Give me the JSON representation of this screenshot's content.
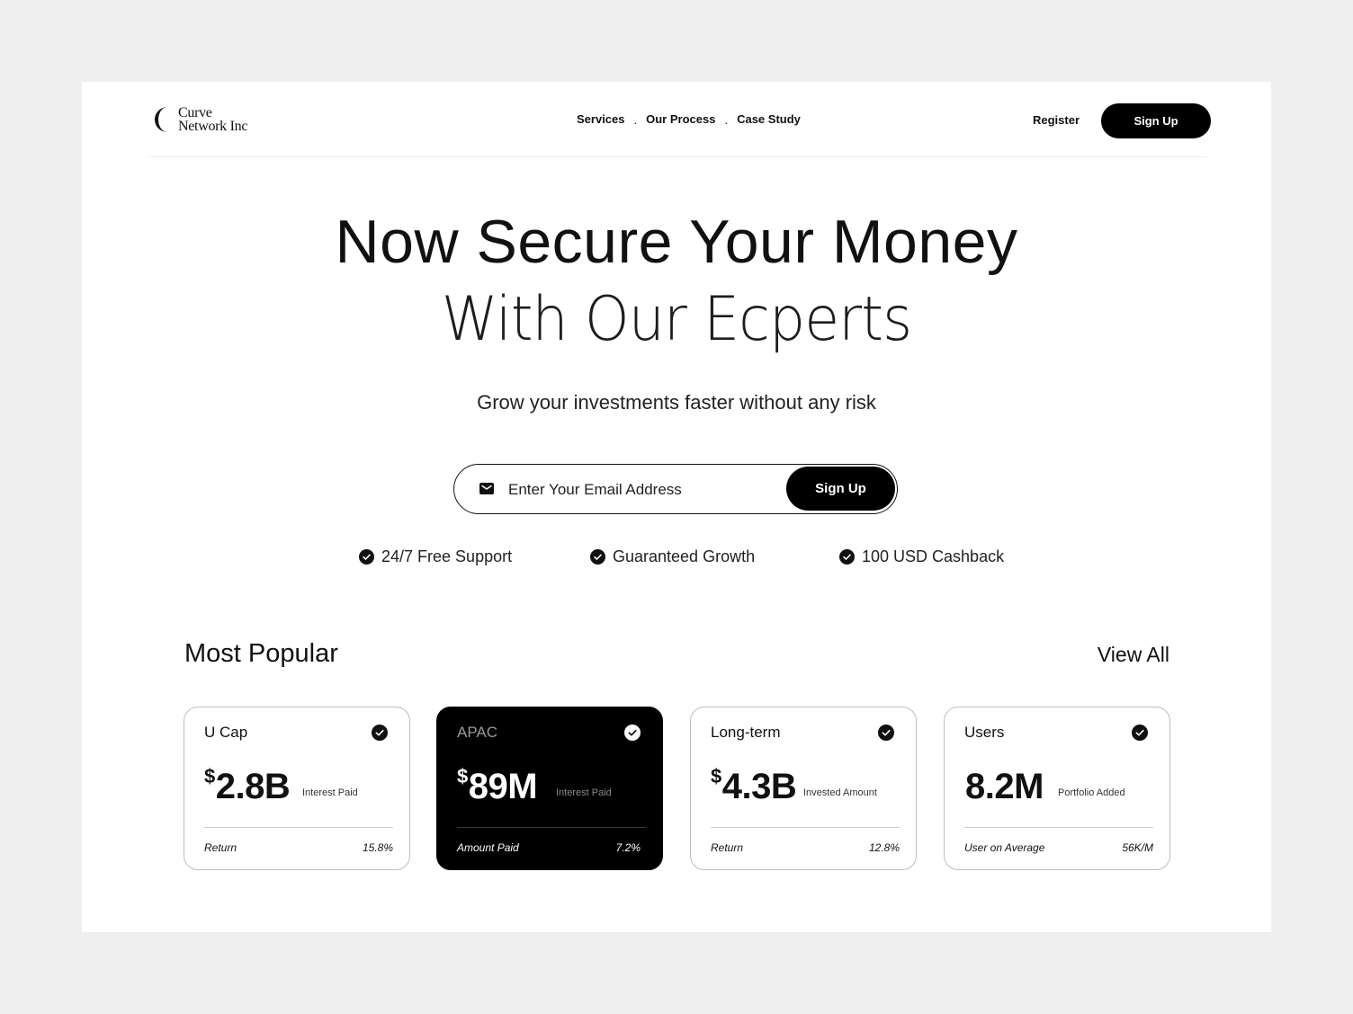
{
  "header": {
    "logo_line1": "Curve",
    "logo_line2": "Network Inc",
    "nav": [
      "Services",
      "Our Process",
      "Case Study"
    ],
    "nav_separator": ".",
    "register_label": "Register",
    "signup_label": "Sign Up"
  },
  "hero": {
    "title_line1": "Now Secure Your Money",
    "title_line2": "With Our Ecperts",
    "subtitle": "Grow your investments faster without any risk",
    "email_placeholder": "Enter Your Email Address",
    "email_icon": "mail-icon",
    "signup_label": "Sign Up"
  },
  "features": [
    {
      "label": "24/7 Free Support",
      "icon": "check-circle-icon"
    },
    {
      "label": "Guaranteed Growth",
      "icon": "check-circle-icon"
    },
    {
      "label": "100 USD Cashback",
      "icon": "check-circle-icon"
    }
  ],
  "popular": {
    "title": "Most Popular",
    "view_all": "View All",
    "cards": [
      {
        "name": "U Cap",
        "currency": "$",
        "value": "2.8B",
        "caption": "Interest Paid",
        "foot_label": "Return",
        "foot_value": "15.8%",
        "dark": false
      },
      {
        "name": "APAC",
        "currency": "$",
        "value": "89M",
        "caption": "Interest Paid",
        "foot_label": "Amount Paid",
        "foot_value": "7.2%",
        "dark": true
      },
      {
        "name": "Long-term",
        "currency": "$",
        "value": "4.3B",
        "caption": "Invested Amount",
        "foot_label": "Return",
        "foot_value": "12.8%",
        "dark": false
      },
      {
        "name": "Users",
        "currency": "",
        "value": "8.2M",
        "caption": "Portfolio Added",
        "foot_label": "User on Average",
        "foot_value": "56K/M",
        "dark": false
      }
    ]
  },
  "colors": {
    "background": "#efefef",
    "surface": "#ffffff",
    "primary": "#000000",
    "text": "#111111"
  }
}
